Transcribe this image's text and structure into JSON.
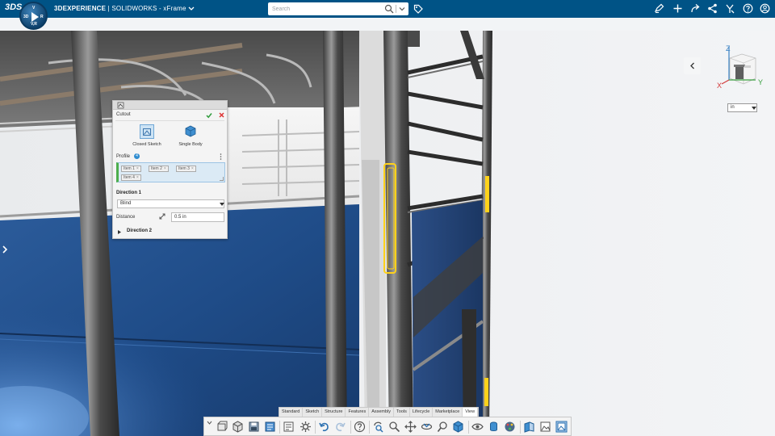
{
  "topbar": {
    "logo": "3DS",
    "compass": {
      "top": "V",
      "left": "3D",
      "right": "R",
      "bottom": "V,R"
    },
    "brand": "3DEXPERIENCE",
    "separator": "|",
    "app_name": "SOLIDWORKS - xFrame",
    "search_placeholder": "Search"
  },
  "cutout": {
    "title": "Cutout",
    "modes": [
      "Closed Sketch",
      "Single Body"
    ],
    "profile_label": "Profile",
    "profile_count": "4",
    "profile_items": [
      "Item 1",
      "Item 2",
      "Item 3",
      "Item 4"
    ],
    "direction1_label": "Direction 1",
    "end_condition": "Blind",
    "distance_label": "Distance",
    "distance_value": "0.5 in",
    "direction2_label": "Direction 2"
  },
  "units": {
    "selected": "in"
  },
  "view_cube": {
    "axis_z": "Z",
    "axis_x": "X",
    "axis_y": "Y"
  },
  "toolbar": {
    "tabs": [
      "Standard",
      "Sketch",
      "Structure",
      "Features",
      "Assembly",
      "Tools",
      "Lifecycle",
      "Marketplace",
      "View"
    ],
    "active_tab": "View"
  },
  "colors": {
    "topbar": "#005386",
    "accent": "#2e8cd0",
    "selection_yellow": "#ffd21a",
    "panel_blue": "#2a5a9a"
  }
}
